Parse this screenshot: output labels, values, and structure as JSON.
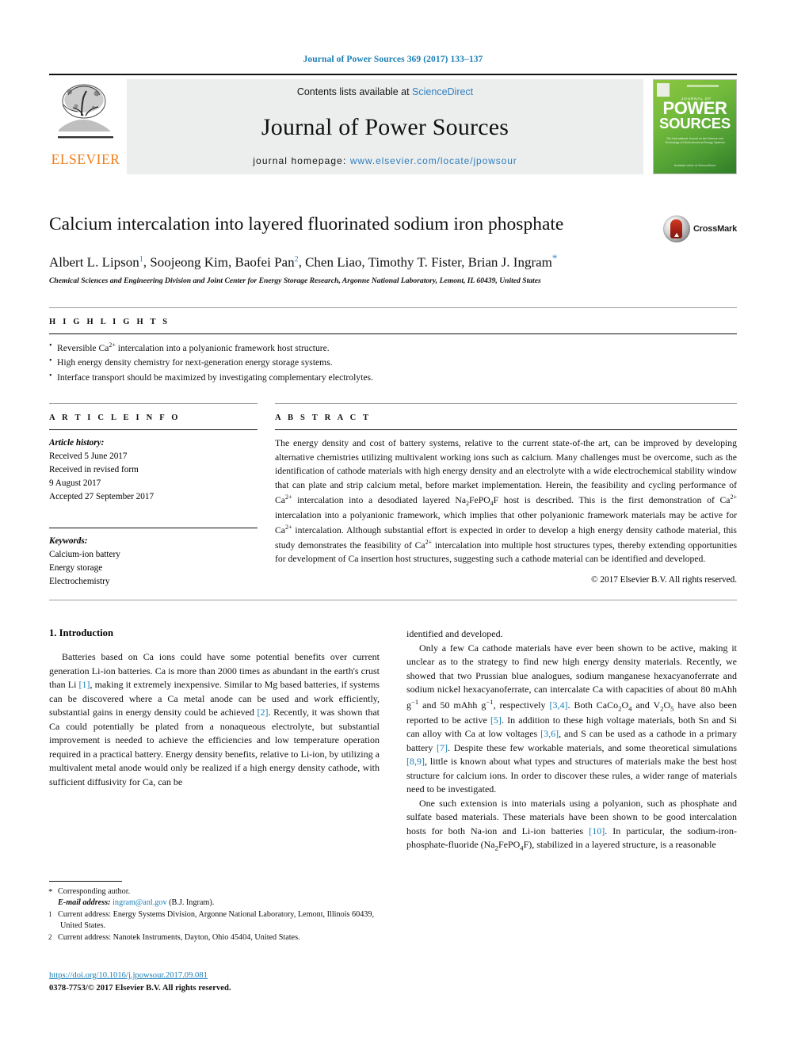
{
  "running_head": "Journal of Power Sources 369 (2017) 133–137",
  "masthead": {
    "publisher_word": "ELSEVIER",
    "contents_prefix": "Contents lists available at ",
    "contents_link": "ScienceDirect",
    "journal_name": "Journal of Power Sources",
    "homepage_label": "journal homepage: ",
    "homepage_url": "www.elsevier.com/locate/jpowsour",
    "cover": {
      "kicker": "JOURNAL OF",
      "title_line1": "POWER",
      "title_line2": "SOURCES",
      "subtitle": "The International Journal on the Science and Technology of Electrochemical Energy Systems",
      "footer": "Available online at\nScienceDirect"
    }
  },
  "article": {
    "title": "Calcium intercalation into layered fluorinated sodium iron phosphate",
    "crossmark_label": "CrossMark",
    "authors": "Albert L. Lipson , Soojeong Kim, Baofei Pan , Chen Liao, Timothy T. Fister, Brian J. Ingram",
    "author_marks": {
      "lipson": "1",
      "pan": "2",
      "ingram": "*"
    },
    "affiliation": "Chemical Sciences and Engineering Division and Joint Center for Energy Storage Research, Argonne National Laboratory, Lemont, IL 60439, United States"
  },
  "highlights": {
    "heading": "H I G H L I G H T S",
    "items": [
      "Reversible Ca2+ intercalation into a polyanionic framework host structure.",
      "High energy density chemistry for next-generation energy storage systems.",
      "Interface transport should be maximized by investigating complementary electrolytes."
    ]
  },
  "article_info": {
    "heading": "A R T I C L E   I N F O",
    "history_label": "Article history:",
    "history_lines": [
      "Received 5 June 2017",
      "Received in revised form",
      "9 August 2017",
      "Accepted 27 September 2017"
    ],
    "keywords_label": "Keywords:",
    "keywords": [
      "Calcium-ion battery",
      "Energy storage",
      "Electrochemistry"
    ]
  },
  "abstract": {
    "heading": "A B S T R A C T",
    "text": "The energy density and cost of battery systems, relative to the current state-of-the art, can be improved by developing alternative chemistries utilizing multivalent working ions such as calcium. Many challenges must be overcome, such as the identification of cathode materials with high energy density and an electrolyte with a wide electrochemical stability window that can plate and strip calcium metal, before market implementation. Herein, the feasibility and cycling performance of Ca2+ intercalation into a desodiated layered Na2FePO4F host is described. This is the first demonstration of Ca2+ intercalation into a polyanionic framework, which implies that other polyanionic framework materials may be active for Ca2+ intercalation. Although substantial effort is expected in order to develop a high energy density cathode material, this study demonstrates the feasibility of Ca2+ intercalation into multiple host structures types, thereby extending opportunities for development of Ca insertion host structures, suggesting such a cathode material can be identified and developed.",
    "copyright": "© 2017 Elsevier B.V. All rights reserved."
  },
  "body": {
    "section_number_title": "1.  Introduction",
    "left_paragraph": "Batteries based on Ca ions could have some potential benefits over current generation Li-ion batteries. Ca is more than 2000 times as abundant in the earth's crust than Li [1], making it extremely inexpensive. Similar to Mg based batteries, if systems can be discovered where a Ca metal anode can be used and work efficiently, substantial gains in energy density could be achieved [2]. Recently, it was shown that Ca could potentially be plated from a nonaqueous electrolyte, but substantial improvement is needed to achieve the efficiencies and low temperature operation required in a practical battery. Energy density benefits, relative to Li-ion, by utilizing a multivalent metal anode would only be realized if a high energy density cathode, with sufficient diffusivity for Ca, can be",
    "right_carryover": "identified and developed.",
    "right_paragraph_1": "Only a few Ca cathode materials have ever been shown to be active, making it unclear as to the strategy to find new high energy density materials. Recently, we showed that two Prussian blue analogues, sodium manganese hexacyanoferrate and sodium nickel hexacyanoferrate, can intercalate Ca with capacities of about 80 mAhh g−1 and 50 mAhh g−1, respectively [3,4]. Both CaCo2O4 and V2O5 have also been reported to be active [5]. In addition to these high voltage materials, both Sn and Si can alloy with Ca at low voltages [3,6], and S can be used as a cathode in a primary battery [7]. Despite these few workable materials, and some theoretical simulations [8,9], little is known about what types and structures of materials make the best host structure for calcium ions. In order to discover these rules, a wider range of materials need to be investigated.",
    "right_paragraph_2": "One such extension is into materials using a polyanion, such as phosphate and sulfate based materials. These materials have been shown to be good intercalation hosts for both Na-ion and Li-ion batteries [10]. In particular, the sodium-iron-phosphate-fluoride (Na2FePO4F), stabilized in a layered structure, is a reasonable"
  },
  "footnotes": {
    "corresponding": "Corresponding author.",
    "email_label": "E-mail address: ",
    "email": "ingram@anl.gov",
    "email_suffix": " (B.J. Ingram).",
    "note1": "Current address: Energy Systems Division, Argonne National Laboratory, Lemont, Illinois 60439, United States.",
    "note2": "Current address: Nanotek Instruments, Dayton, Ohio 45404, United States."
  },
  "footer": {
    "doi": "https://doi.org/10.1016/j.jpowsour.2017.09.081",
    "issn": "0378-7753/© 2017 Elsevier B.V. All rights reserved."
  },
  "colors": {
    "link_blue": "#1a7fb5",
    "sd_blue": "#2f7fbf",
    "elsevier_orange": "#ef7d1a",
    "band_gray": "#eceded"
  }
}
